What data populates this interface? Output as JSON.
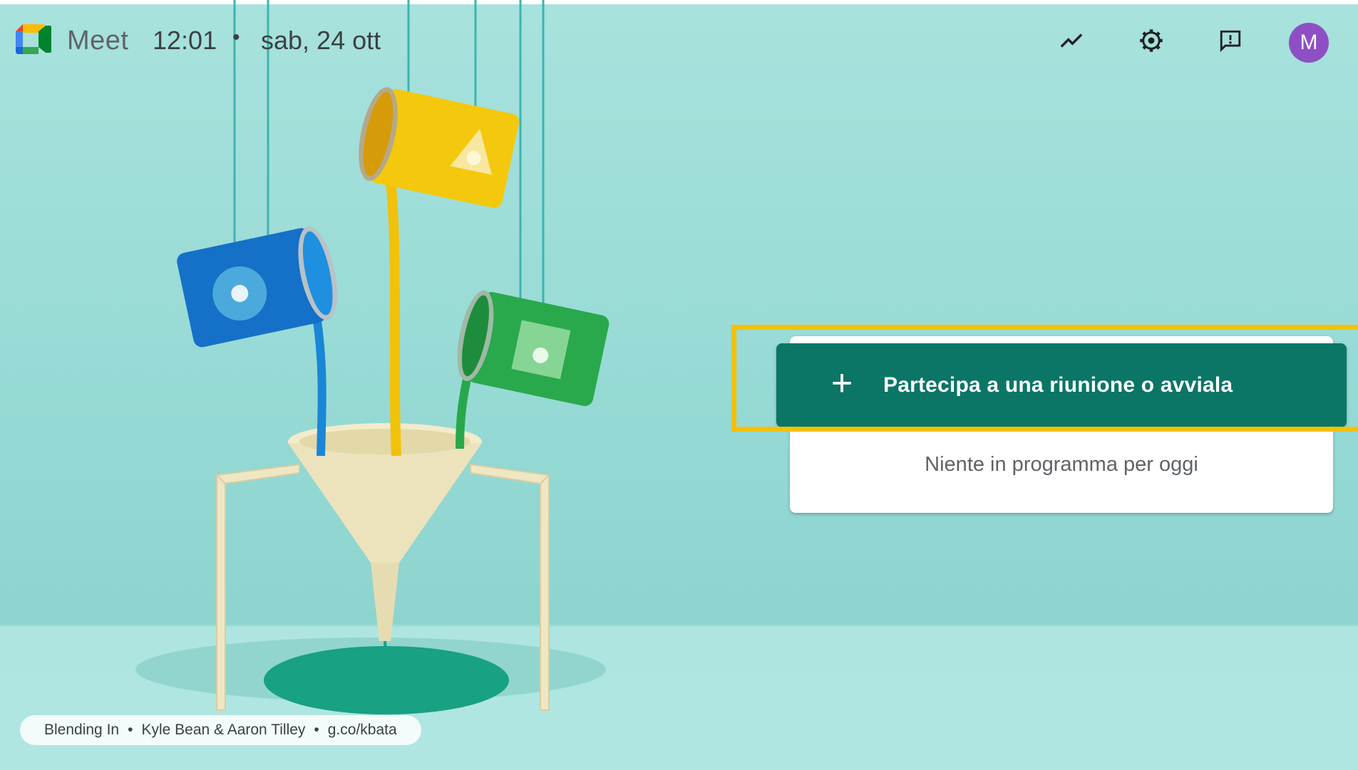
{
  "header": {
    "app_name": "Meet",
    "time": "12:01",
    "separator": "•",
    "date": "sab, 24 ott",
    "icons": [
      "activity-icon",
      "gear-icon",
      "feedback-icon"
    ],
    "avatar_initial": "M"
  },
  "card": {
    "join_button_label": "Partecipa a una riunione o avviala",
    "join_button_icon": "+",
    "empty_message": "Niente in programma per oggi"
  },
  "attribution": {
    "title": "Blending In",
    "artists": "Kyle Bean & Aaron Tilley",
    "link": "g.co/kbata",
    "separator": "•"
  },
  "colors": {
    "accent": "#0b7566",
    "highlight": "#f5c000",
    "avatar": "#8e4fc4",
    "background": "#9fddd8"
  }
}
